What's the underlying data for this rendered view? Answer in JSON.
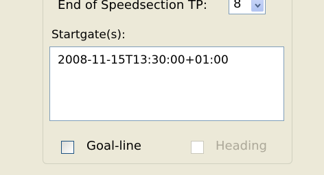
{
  "speedsection": {
    "end_label": "End of Speedsection TP:",
    "end_value": "8"
  },
  "startgates": {
    "label": "Startgate(s):",
    "items": [
      "2008-11-15T13:30:00+01:00"
    ]
  },
  "options": {
    "goal_line": {
      "label": "Goal-line",
      "checked": false,
      "enabled": true
    },
    "heading": {
      "label": "Heading",
      "checked": false,
      "enabled": false
    }
  },
  "icons": {
    "combo_dropdown": "chevron-down-icon"
  },
  "colors": {
    "window_bg": "#ece9d8",
    "field_border": "#7f9db9",
    "disabled_text": "#aca899"
  }
}
